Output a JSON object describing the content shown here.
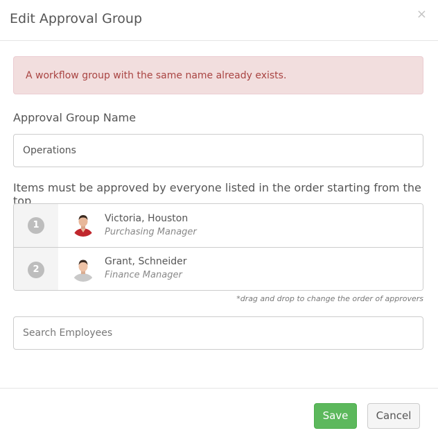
{
  "modal": {
    "title": "Edit Approval Group",
    "close_icon": "×"
  },
  "alert": {
    "message": "A workflow group with the same name already exists."
  },
  "group_name": {
    "label": "Approval Group Name",
    "value": "Operations"
  },
  "approvers": {
    "instructions": "Items must be approved by everyone listed in the order starting from the top",
    "items": [
      {
        "order": "1",
        "name": "Victoria, Houston",
        "title": "Purchasing Manager",
        "avatar_icon": "person-red-shirt-avatar"
      },
      {
        "order": "2",
        "name": "Grant, Schneider",
        "title": "Finance Manager",
        "avatar_icon": "person-grey-shirt-avatar"
      }
    ],
    "hint": "*drag and drop to change the order of approvers"
  },
  "search": {
    "placeholder": "Search Employees",
    "value": ""
  },
  "footer": {
    "save_label": "Save",
    "cancel_label": "Cancel"
  },
  "colors": {
    "alert_bg": "#f2dede",
    "alert_text": "#a94442",
    "save_button": "#5cb85c",
    "badge": "#bdbdbd"
  }
}
